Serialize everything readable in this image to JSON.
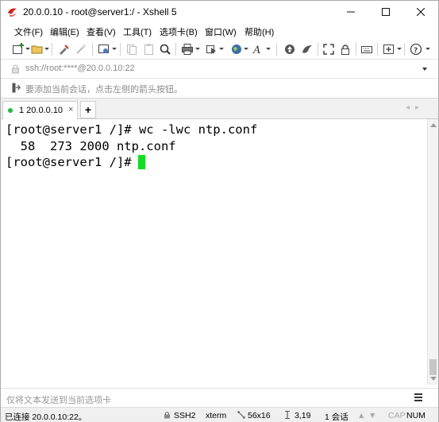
{
  "window": {
    "title": "20.0.0.10 - root@server1:/ - Xshell 5"
  },
  "menu": {
    "items": [
      "文件(F)",
      "编辑(E)",
      "查看(V)",
      "工具(T)",
      "选项卡(B)",
      "窗口(W)",
      "帮助(H)"
    ]
  },
  "address": {
    "text": "ssh://root:****@20.0.0.10:22"
  },
  "hint": {
    "text": "要添加当前会话，点击左侧的箭头按钮。"
  },
  "tabs": {
    "items": [
      {
        "label": "1 20.0.0.10",
        "close": "×"
      }
    ],
    "add_label": "+",
    "nav_prev": "◂",
    "nav_next": "▸"
  },
  "terminal": {
    "lines": [
      "[root@server1 /]# wc -lwc ntp.conf",
      "  58  273 2000 ntp.conf",
      "[root@server1 /]# "
    ]
  },
  "compose": {
    "placeholder": "仅将文本发送到当前选项卡"
  },
  "status": {
    "connection": "已连接 20.0.0.10:22。",
    "protocol": "SSH2",
    "terminal_type": "xterm",
    "size": "56x16",
    "cursor_pos": "3,19",
    "sessions": "1 会话",
    "cap": "CAP",
    "num": "NUM"
  },
  "colors": {
    "cursor": "#11dd22",
    "tab_indicator": "#22bb44",
    "app_icon": "#cc2222"
  },
  "icons": {
    "app": "xshell-logo-icon",
    "window_controls": [
      "minimize-icon",
      "maximize-icon",
      "close-icon"
    ],
    "toolbar": [
      "new-session-icon",
      "open-folder-icon",
      "reconnect-icon",
      "disconnect-icon",
      "properties-icon",
      "copy-icon",
      "paste-icon",
      "find-icon",
      "print-icon",
      "transfer-icon",
      "globe-icon",
      "font-icon",
      "xftp-icon",
      "xagent-icon",
      "fullscreen-icon",
      "lock-icon",
      "keyboard-icon",
      "add-pane-icon",
      "help-icon"
    ]
  }
}
